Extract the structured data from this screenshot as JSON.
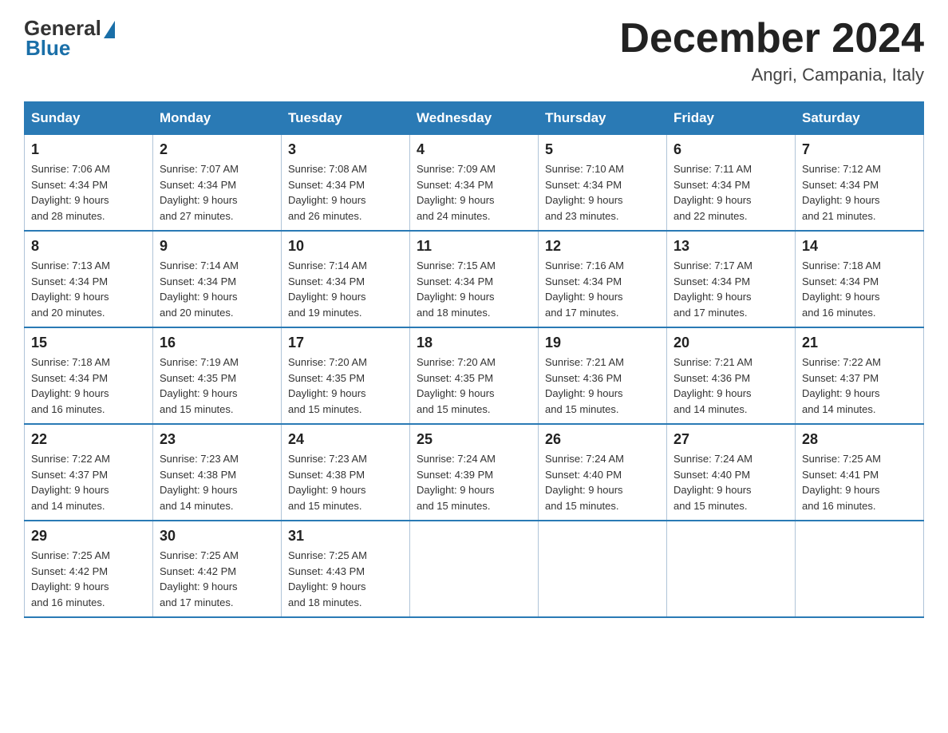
{
  "header": {
    "logo_general": "General",
    "logo_blue": "Blue",
    "title": "December 2024",
    "subtitle": "Angri, Campania, Italy"
  },
  "days_of_week": [
    "Sunday",
    "Monday",
    "Tuesday",
    "Wednesday",
    "Thursday",
    "Friday",
    "Saturday"
  ],
  "weeks": [
    [
      {
        "day": "1",
        "sunrise": "7:06 AM",
        "sunset": "4:34 PM",
        "daylight": "9 hours and 28 minutes."
      },
      {
        "day": "2",
        "sunrise": "7:07 AM",
        "sunset": "4:34 PM",
        "daylight": "9 hours and 27 minutes."
      },
      {
        "day": "3",
        "sunrise": "7:08 AM",
        "sunset": "4:34 PM",
        "daylight": "9 hours and 26 minutes."
      },
      {
        "day": "4",
        "sunrise": "7:09 AM",
        "sunset": "4:34 PM",
        "daylight": "9 hours and 24 minutes."
      },
      {
        "day": "5",
        "sunrise": "7:10 AM",
        "sunset": "4:34 PM",
        "daylight": "9 hours and 23 minutes."
      },
      {
        "day": "6",
        "sunrise": "7:11 AM",
        "sunset": "4:34 PM",
        "daylight": "9 hours and 22 minutes."
      },
      {
        "day": "7",
        "sunrise": "7:12 AM",
        "sunset": "4:34 PM",
        "daylight": "9 hours and 21 minutes."
      }
    ],
    [
      {
        "day": "8",
        "sunrise": "7:13 AM",
        "sunset": "4:34 PM",
        "daylight": "9 hours and 20 minutes."
      },
      {
        "day": "9",
        "sunrise": "7:14 AM",
        "sunset": "4:34 PM",
        "daylight": "9 hours and 20 minutes."
      },
      {
        "day": "10",
        "sunrise": "7:14 AM",
        "sunset": "4:34 PM",
        "daylight": "9 hours and 19 minutes."
      },
      {
        "day": "11",
        "sunrise": "7:15 AM",
        "sunset": "4:34 PM",
        "daylight": "9 hours and 18 minutes."
      },
      {
        "day": "12",
        "sunrise": "7:16 AM",
        "sunset": "4:34 PM",
        "daylight": "9 hours and 17 minutes."
      },
      {
        "day": "13",
        "sunrise": "7:17 AM",
        "sunset": "4:34 PM",
        "daylight": "9 hours and 17 minutes."
      },
      {
        "day": "14",
        "sunrise": "7:18 AM",
        "sunset": "4:34 PM",
        "daylight": "9 hours and 16 minutes."
      }
    ],
    [
      {
        "day": "15",
        "sunrise": "7:18 AM",
        "sunset": "4:34 PM",
        "daylight": "9 hours and 16 minutes."
      },
      {
        "day": "16",
        "sunrise": "7:19 AM",
        "sunset": "4:35 PM",
        "daylight": "9 hours and 15 minutes."
      },
      {
        "day": "17",
        "sunrise": "7:20 AM",
        "sunset": "4:35 PM",
        "daylight": "9 hours and 15 minutes."
      },
      {
        "day": "18",
        "sunrise": "7:20 AM",
        "sunset": "4:35 PM",
        "daylight": "9 hours and 15 minutes."
      },
      {
        "day": "19",
        "sunrise": "7:21 AM",
        "sunset": "4:36 PM",
        "daylight": "9 hours and 15 minutes."
      },
      {
        "day": "20",
        "sunrise": "7:21 AM",
        "sunset": "4:36 PM",
        "daylight": "9 hours and 14 minutes."
      },
      {
        "day": "21",
        "sunrise": "7:22 AM",
        "sunset": "4:37 PM",
        "daylight": "9 hours and 14 minutes."
      }
    ],
    [
      {
        "day": "22",
        "sunrise": "7:22 AM",
        "sunset": "4:37 PM",
        "daylight": "9 hours and 14 minutes."
      },
      {
        "day": "23",
        "sunrise": "7:23 AM",
        "sunset": "4:38 PM",
        "daylight": "9 hours and 14 minutes."
      },
      {
        "day": "24",
        "sunrise": "7:23 AM",
        "sunset": "4:38 PM",
        "daylight": "9 hours and 15 minutes."
      },
      {
        "day": "25",
        "sunrise": "7:24 AM",
        "sunset": "4:39 PM",
        "daylight": "9 hours and 15 minutes."
      },
      {
        "day": "26",
        "sunrise": "7:24 AM",
        "sunset": "4:40 PM",
        "daylight": "9 hours and 15 minutes."
      },
      {
        "day": "27",
        "sunrise": "7:24 AM",
        "sunset": "4:40 PM",
        "daylight": "9 hours and 15 minutes."
      },
      {
        "day": "28",
        "sunrise": "7:25 AM",
        "sunset": "4:41 PM",
        "daylight": "9 hours and 16 minutes."
      }
    ],
    [
      {
        "day": "29",
        "sunrise": "7:25 AM",
        "sunset": "4:42 PM",
        "daylight": "9 hours and 16 minutes."
      },
      {
        "day": "30",
        "sunrise": "7:25 AM",
        "sunset": "4:42 PM",
        "daylight": "9 hours and 17 minutes."
      },
      {
        "day": "31",
        "sunrise": "7:25 AM",
        "sunset": "4:43 PM",
        "daylight": "9 hours and 18 minutes."
      },
      null,
      null,
      null,
      null
    ]
  ],
  "labels": {
    "sunrise": "Sunrise:",
    "sunset": "Sunset:",
    "daylight": "Daylight:"
  }
}
